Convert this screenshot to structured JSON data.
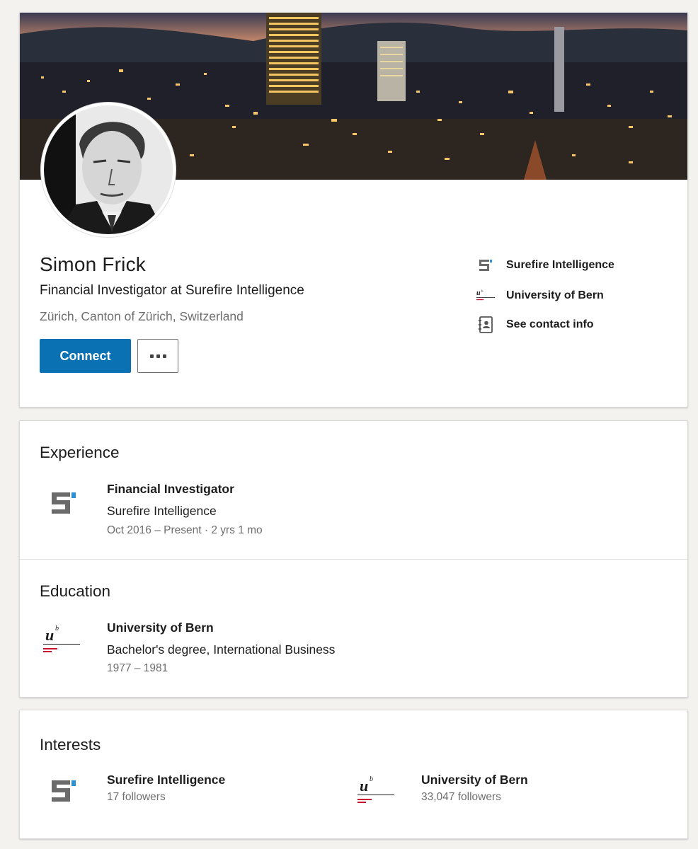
{
  "profile": {
    "name": "Simon Frick",
    "headline": "Financial Investigator at Surefire Intelligence",
    "location": "Zürich, Canton of Zürich, Switzerland",
    "connect_label": "Connect",
    "more_label": "...",
    "side_links": [
      {
        "label": "Surefire Intelligence",
        "icon": "surefire-logo"
      },
      {
        "label": "University of Bern",
        "icon": "unibe-logo"
      },
      {
        "label": "See contact info",
        "icon": "contact-book-icon"
      }
    ]
  },
  "experience": {
    "title": "Experience",
    "items": [
      {
        "role": "Financial Investigator",
        "company": "Surefire Intelligence",
        "dates": "Oct 2016 – Present · 2 yrs 1 mo"
      }
    ]
  },
  "education": {
    "title": "Education",
    "items": [
      {
        "school": "University of Bern",
        "degree": "Bachelor's degree, International Business",
        "dates": "1977 – 1981"
      }
    ]
  },
  "interests": {
    "title": "Interests",
    "items": [
      {
        "name": "Surefire Intelligence",
        "followers": "17 followers"
      },
      {
        "name": "University of Bern",
        "followers": "33,047 followers"
      }
    ]
  },
  "colors": {
    "accent": "#0a71b3",
    "unibe_red": "#c8102e",
    "surefire_gray": "#6b6b6b",
    "surefire_blue": "#2d8fd6"
  }
}
